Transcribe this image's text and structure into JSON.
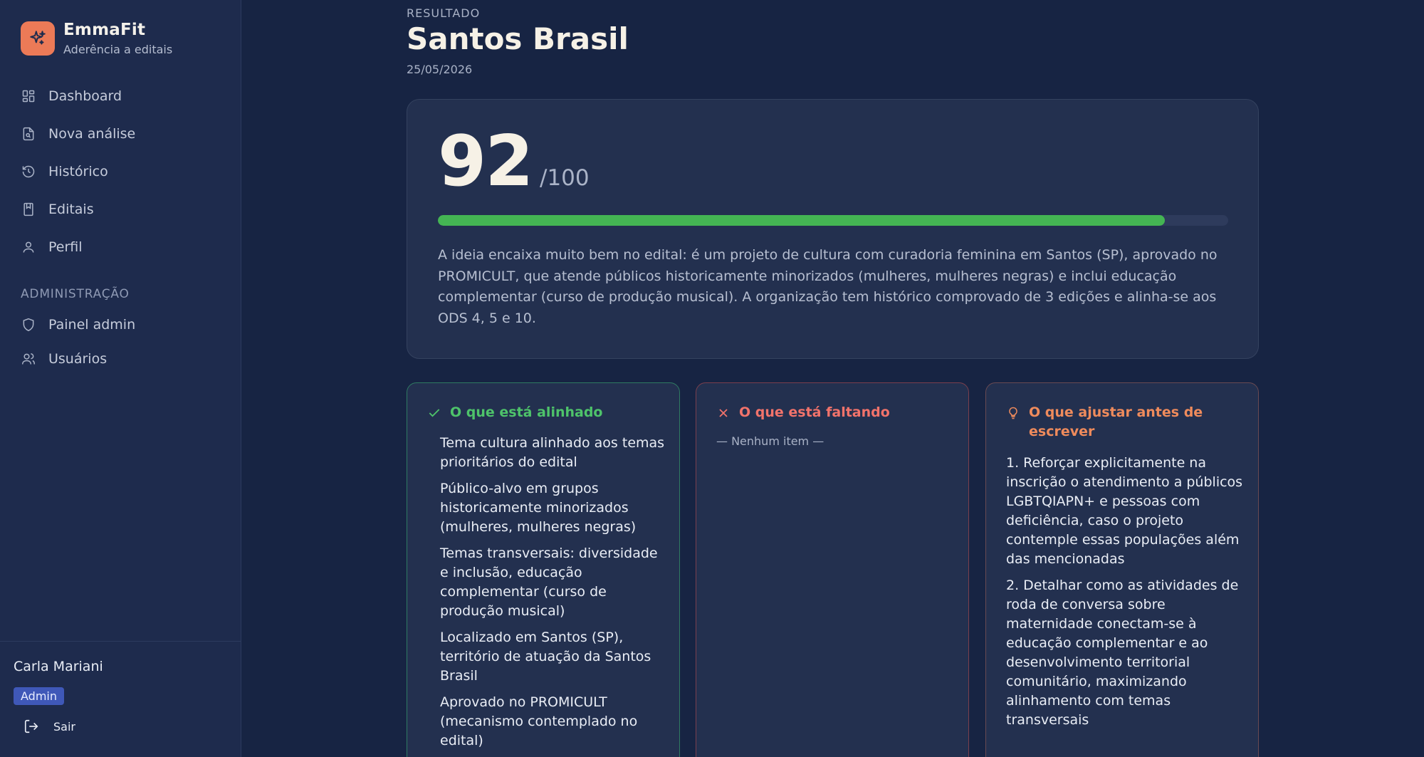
{
  "brand": {
    "name": "EmmaFit",
    "subtitle": "Aderência a editais"
  },
  "nav": {
    "items": [
      {
        "label": "Dashboard",
        "icon": "dashboard-icon"
      },
      {
        "label": "Nova análise",
        "icon": "file-search-icon"
      },
      {
        "label": "Histórico",
        "icon": "history-icon"
      },
      {
        "label": "Editais",
        "icon": "book-icon"
      },
      {
        "label": "Perfil",
        "icon": "user-icon"
      }
    ],
    "section_label": "ADMINISTRAÇÃO",
    "admin_items": [
      {
        "label": "Painel admin",
        "icon": "shield-icon"
      },
      {
        "label": "Usuários",
        "icon": "users-icon"
      }
    ]
  },
  "user": {
    "name": "Carla Mariani",
    "role": "Admin",
    "logout_label": "Sair"
  },
  "result": {
    "eyebrow": "RESULTADO",
    "title": "Santos Brasil",
    "date": "25/05/2026",
    "score": "92",
    "score_max": "/100",
    "score_fraction": 0.92,
    "summary": "A ideia encaixa muito bem no edital: é um projeto de cultura com curadoria feminina em Santos (SP), aprovado no PROMICULT, que atende públicos historicamente minorizados (mulheres, mulheres negras) e inclui educação complementar (curso de produção musical). A organização tem histórico comprovado de 3 edições e alinha-se aos ODS 4, 5 e 10."
  },
  "columns": {
    "aligned": {
      "title": "O que está alinhado",
      "items": [
        "Tema cultura alinhado aos temas prioritários do edital",
        "Público-alvo em grupos historicamente minorizados (mulheres, mulheres negras)",
        "Temas transversais: diversidade e inclusão, educação complementar (curso de produção musical)",
        "Localizado em Santos (SP), território de atuação da Santos Brasil",
        "Aprovado no PROMICULT (mecanismo contemplado no edital)"
      ]
    },
    "missing": {
      "title": "O que está faltando",
      "empty": "— Nenhum item —"
    },
    "adjust": {
      "title": "O que ajustar antes de escrever",
      "items": [
        "1. Reforçar explicitamente na inscrição o atendimento a públicos LGBTQIAPN+ e pessoas com deficiência, caso o projeto contemple essas populações além das mencionadas",
        "2. Detalhar como as atividades de roda de conversa sobre maternidade conectam-se à educação complementar e ao desenvolvimento territorial comunitário, maximizando alinhamento com temas transversais"
      ]
    }
  },
  "colors": {
    "accent": "#ec7a57",
    "success": "#44b553",
    "danger": "#f2736b",
    "warning": "#ef8b5c"
  }
}
